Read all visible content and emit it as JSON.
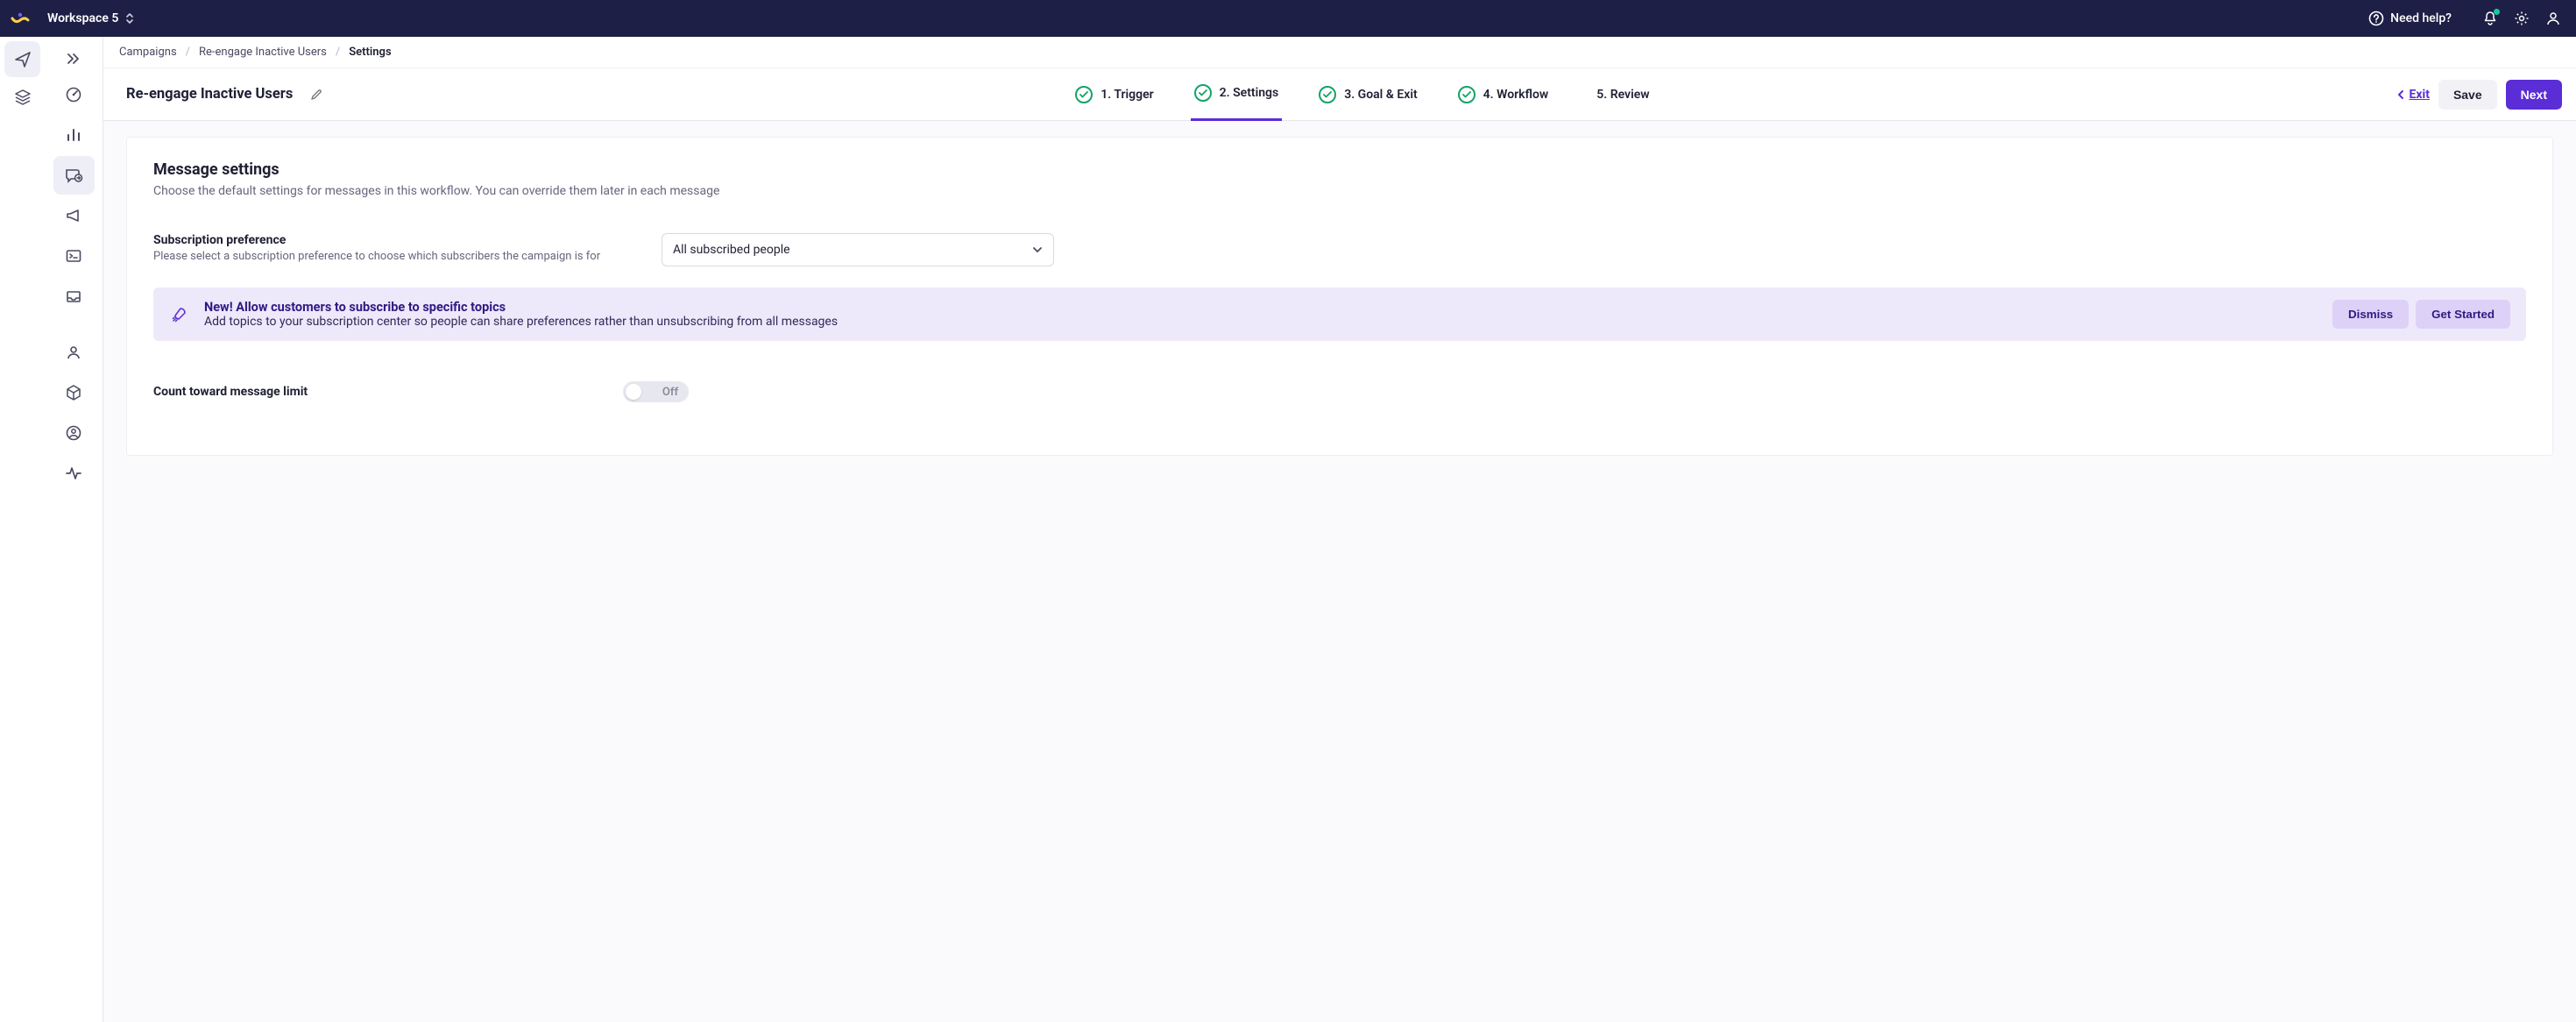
{
  "topbar": {
    "workspace": "Workspace 5",
    "need_help": "Need help?"
  },
  "breadcrumbs": {
    "items": [
      "Campaigns",
      "Re-engage Inactive Users",
      "Settings"
    ]
  },
  "subheader": {
    "title": "Re-engage Inactive Users",
    "exit": "Exit",
    "save": "Save",
    "next": "Next"
  },
  "steps": [
    {
      "label": "1. Trigger",
      "done": true
    },
    {
      "label": "2. Settings",
      "done": true,
      "active": true
    },
    {
      "label": "3. Goal & Exit",
      "done": true
    },
    {
      "label": "4. Workflow",
      "done": true
    },
    {
      "label": "5. Review",
      "done": false
    }
  ],
  "card": {
    "heading": "Message settings",
    "sub": "Choose the default settings for messages in this workflow. You can override them later in each message",
    "subscription": {
      "label": "Subscription preference",
      "help": "Please select a subscription preference to choose which subscribers the campaign is for",
      "value": "All subscribed people"
    },
    "banner": {
      "title": "New! Allow customers to subscribe to specific topics",
      "desc": "Add topics to your subscription center so people can share preferences rather than unsubscribing from all messages",
      "dismiss": "Dismiss",
      "get_started": "Get Started"
    },
    "limit": {
      "label": "Count toward message limit",
      "state": "Off"
    }
  }
}
